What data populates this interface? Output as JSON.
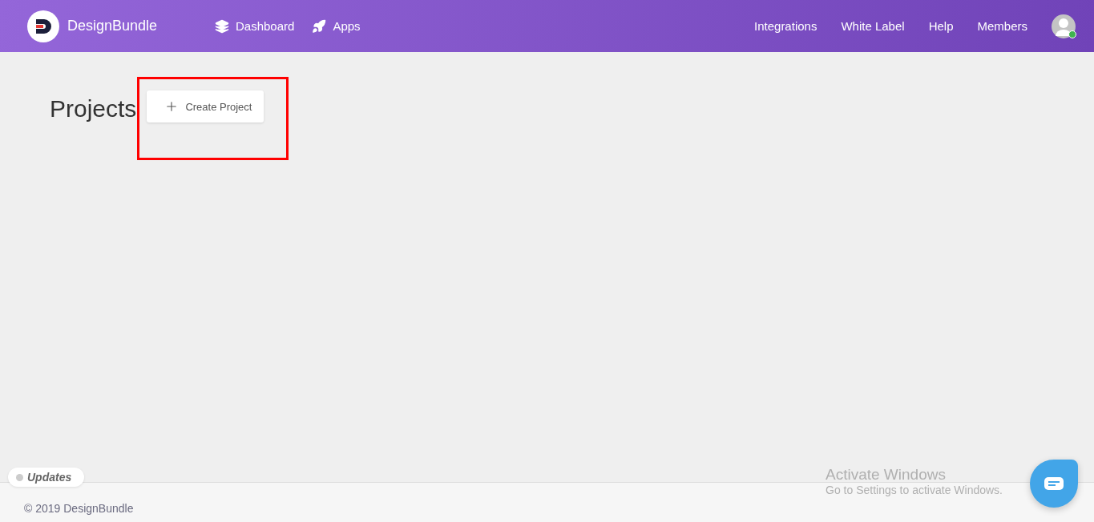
{
  "header": {
    "brand": "DesignBundle",
    "nav": [
      {
        "label": "Dashboard",
        "kind": "layers"
      },
      {
        "label": "Apps",
        "kind": "rocket"
      }
    ],
    "links": [
      "Integrations",
      "White Label",
      "Help",
      "Members"
    ],
    "avatar": {
      "online": true
    }
  },
  "page": {
    "title": "Projects",
    "create_button": "Create Project",
    "highlighted": true
  },
  "updates_badge": {
    "label": "Updates"
  },
  "footer": {
    "copyright": "© 2019 DesignBundle"
  },
  "activation_notice": {
    "title": "Activate Windows",
    "subtitle": "Go to Settings to activate Windows."
  }
}
